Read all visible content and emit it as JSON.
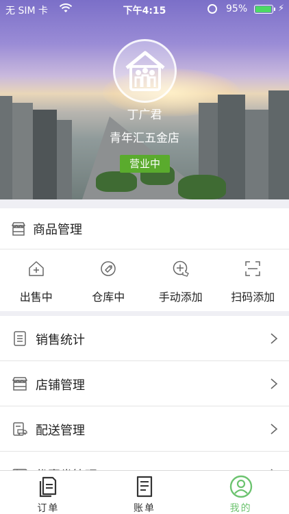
{
  "status_bar": {
    "carrier": "无 SIM 卡",
    "time": "下午4:15",
    "battery": "95%",
    "battery_level": 0.95
  },
  "store": {
    "owner": "丁广君",
    "name": "青年汇五金店",
    "status": "营业中"
  },
  "goods": {
    "title": "商品管理",
    "actions": [
      {
        "label": "出售中",
        "icon": "house-plus-icon"
      },
      {
        "label": "仓库中",
        "icon": "tag-icon"
      },
      {
        "label": "手动添加",
        "icon": "add-hand-icon"
      },
      {
        "label": "扫码添加",
        "icon": "scan-icon"
      }
    ]
  },
  "menu": {
    "items": [
      {
        "label": "销售统计",
        "icon": "document-icon"
      },
      {
        "label": "店铺管理",
        "icon": "shop-icon"
      },
      {
        "label": "配送管理",
        "icon": "delivery-icon"
      },
      {
        "label": "优惠券管理",
        "icon": "coupon-icon"
      }
    ]
  },
  "tabbar": {
    "tabs": [
      {
        "label": "订单",
        "icon": "orders-icon"
      },
      {
        "label": "账单",
        "icon": "bill-icon"
      },
      {
        "label": "我的",
        "icon": "profile-icon",
        "active": true
      }
    ]
  },
  "colors": {
    "accent_green": "#5aab2d",
    "tab_active": "#6cc36f"
  }
}
